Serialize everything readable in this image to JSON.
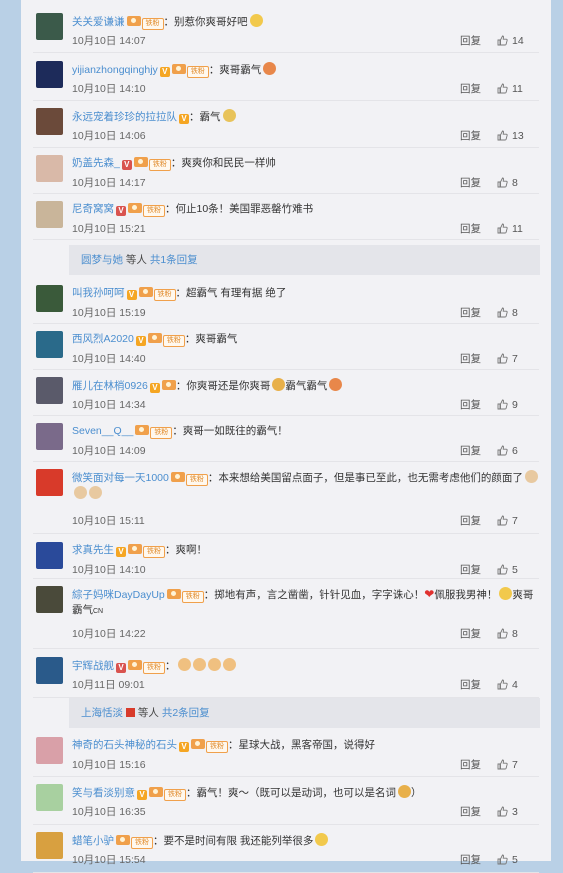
{
  "comments": [
    {
      "user": "关关爱谦谦",
      "badges": [
        "ic",
        "fan"
      ],
      "text": "：别惹你爽哥好吧",
      "emoji": [
        "#f2c94c"
      ],
      "time": "10月10日 14:07",
      "reply": "回复",
      "likes": "14",
      "avatar": "#3b5a4a"
    },
    {
      "user": "yijianzhongqinghjy",
      "badges": [
        "v",
        "ic",
        "fan"
      ],
      "text": "：爽哥霸气",
      "emoji": [
        "#e8874a"
      ],
      "time": "10月10日 14:10",
      "reply": "回复",
      "likes": "11",
      "avatar": "#1d2b5a"
    },
    {
      "user": "永远宠着珍珍的拉拉队",
      "badges": [
        "v"
      ],
      "text": "：霸气",
      "emoji": [
        "#e8c35a"
      ],
      "time": "10月10日 14:06",
      "reply": "回复",
      "likes": "13",
      "avatar": "#6b4a3a"
    },
    {
      "user": "奶盖先森_",
      "badges": [
        "vred",
        "ic",
        "fan"
      ],
      "text": "：爽爽你和民民一样帅",
      "emoji": [],
      "time": "10月10日 14:17",
      "reply": "回复",
      "likes": "8",
      "avatar": "#d9b9a8"
    },
    {
      "user": "尼奇窝窝",
      "badges": [
        "vred",
        "ic",
        "fan"
      ],
      "text": "：何止10条！美国罪恶罄竹难书",
      "emoji": [],
      "time": "10月10日 15:21",
      "reply": "回复",
      "likes": "11",
      "avatar": "#c9b59a"
    },
    {
      "user": "叫我孙呵呵",
      "badges": [
        "v",
        "ic",
        "fan"
      ],
      "text": "：超霸气 有理有据 绝了",
      "emoji": [],
      "time": "10月10日 15:19",
      "reply": "回复",
      "likes": "8",
      "avatar": "#3a5a3a"
    },
    {
      "user": "西风烈A2020",
      "badges": [
        "v",
        "ic",
        "fan"
      ],
      "text": "：爽哥霸气",
      "emoji": [],
      "time": "10月10日 14:40",
      "reply": "回复",
      "likes": "7",
      "avatar": "#2a6a8a"
    },
    {
      "user": "雁儿在林梢0926",
      "badges": [
        "v",
        "ic"
      ],
      "text": "：你爽哥还是你爽哥",
      "emoji": [
        "#e8b04a"
      ],
      "text2": "霸气霸气",
      "emoji2": [
        "#e8874a"
      ],
      "time": "10月10日 14:34",
      "reply": "回复",
      "likes": "9",
      "avatar": "#5a5a6a"
    },
    {
      "user": "Seven__Q__",
      "badges": [
        "ic",
        "fan"
      ],
      "text": "：爽哥一如既往的霸气！",
      "emoji": [],
      "time": "10月10日 14:09",
      "reply": "回复",
      "likes": "6",
      "avatar": "#7a6a8a"
    },
    {
      "user": "微笑面对每一天1000",
      "badges": [
        "ic",
        "fan"
      ],
      "text": "：本来想给美国留点面子，但是事已至此，也无需考虑他们的颜面了",
      "emoji": [
        "#e8c9a0",
        "#e8c9a0",
        "#e8c9a0"
      ],
      "time": "10月10日 15:11",
      "reply": "回复",
      "likes": "7",
      "avatar": "#d83a2a",
      "wrap": true
    },
    {
      "user": "求真先生",
      "badges": [
        "v",
        "ic",
        "fan"
      ],
      "text": "：爽啊！",
      "emoji": [],
      "time": "10月10日 14:10",
      "reply": "回复",
      "likes": "5",
      "avatar": "#2a4a9a"
    },
    {
      "user": "綜子妈咪DayDayUp",
      "badges": [
        "ic",
        "fan"
      ],
      "text": "：掷地有声，言之凿凿，针针见血，字字诛心！",
      "heart": "❤",
      "text2": "佩服我男神！",
      "emoji2": [
        "#f2c94c"
      ],
      "text3": "爽哥霸气",
      "small": "CN",
      "time": "10月10日 14:22",
      "reply": "回复",
      "likes": "8",
      "avatar": "#4a4a3a",
      "wrap": true
    },
    {
      "user": "宇辉战舰",
      "badges": [
        "vred",
        "ic",
        "fan"
      ],
      "text": "：",
      "emoji": [
        "#f0c080",
        "#f0c080",
        "#f0c080",
        "#f0c080"
      ],
      "time": "10月11日 09:01",
      "reply": "回复",
      "likes": "4",
      "avatar": "#2a5a8a"
    },
    {
      "user": "神奇的石头神秘的石头",
      "badges": [
        "v",
        "ic",
        "fan"
      ],
      "text": "：星球大战，黑客帝国，说得好",
      "emoji": [],
      "time": "10月10日 15:16",
      "reply": "回复",
      "likes": "7",
      "avatar": "#d9a0a8"
    },
    {
      "user": "笑与看淡别意",
      "badges": [
        "v",
        "ic",
        "fan"
      ],
      "text": "：霸气！爽～（既可以是动词，也可以是名词",
      "emoji": [
        "#e8b04a"
      ],
      "text2": "）",
      "time": "10月10日 16:35",
      "reply": "回复",
      "likes": "3",
      "avatar": "#a8d0a0"
    },
    {
      "user": "蜡笔小驴",
      "badges": [
        "ic",
        "fan"
      ],
      "text": "：要不是时间有限 我还能列举很多",
      "emoji": [
        "#f2c94c"
      ],
      "time": "10月10日 15:54",
      "reply": "回复",
      "likes": "5",
      "avatar": "#d8a040"
    }
  ],
  "subreplies": [
    {
      "prefix": "",
      "user": "圆梦与她",
      "mid": " 等人 ",
      "link": "共1条回复"
    },
    {
      "prefix": "",
      "user": "上海恬淡",
      "mid": " 等人 ",
      "link": "共2条回复",
      "flag": true
    }
  ],
  "fan_label": "铁粉"
}
